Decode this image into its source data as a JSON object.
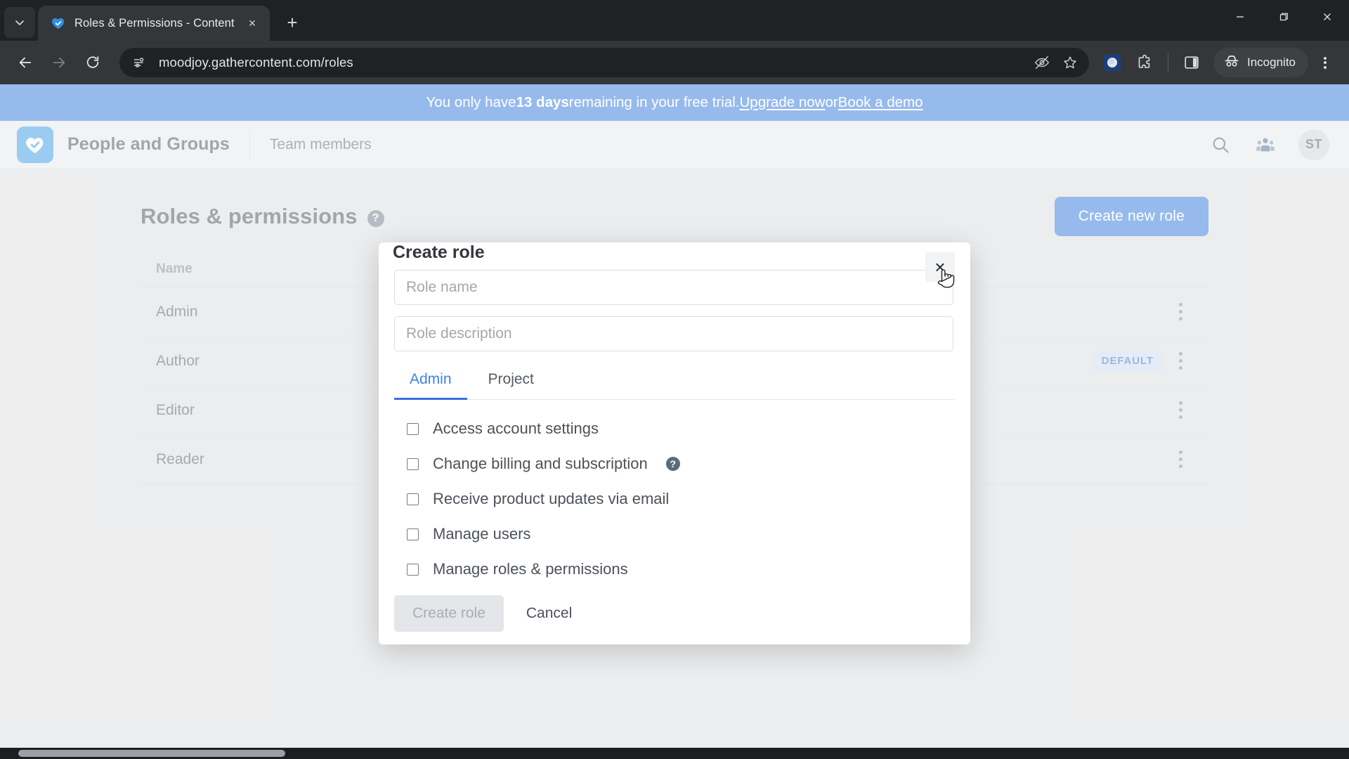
{
  "browser": {
    "tab": {
      "title": "Roles & Permissions - Content",
      "favicon": "gathercontent-heart-icon",
      "close_icon": "×",
      "new_tab_icon": "+",
      "tab_search_icon": "chevron-down-icon"
    },
    "window_controls": {
      "minimize": "minimize-icon",
      "maximize": "maximize-icon",
      "close": "close-icon"
    },
    "toolbar": {
      "back_icon": "arrow-left-icon",
      "forward_icon": "arrow-right-icon",
      "reload_icon": "reload-icon",
      "site_info_icon": "site-settings-icon",
      "url": "moodjoy.gathercontent.com/roles",
      "tracking_icon": "eye-slash-icon",
      "bookmark_icon": "star-icon",
      "profile_icon": "profile-avatar-icon",
      "extensions_icon": "puzzle-piece-icon",
      "sidepanel_icon": "side-panel-icon",
      "incognito_label": "Incognito",
      "incognito_icon": "incognito-hat-icon",
      "menu_icon": "three-dots-vertical-icon"
    }
  },
  "banner": {
    "prefix": "You only have ",
    "days": "13 days",
    "middle": " remaining in your free trial. ",
    "link_upgrade": "Upgrade now",
    "conjunction": " or ",
    "link_demo": "Book a demo",
    "bg_color": "#1a66d8"
  },
  "app_header": {
    "logo": "gathercontent-logo-icon",
    "brand": "People and Groups",
    "nav_item": "Team members",
    "search_icon": "search-icon",
    "groups_icon": "people-group-icon",
    "avatar_initials": "ST"
  },
  "page": {
    "title": "Roles & permissions",
    "title_help_icon": "question-mark-icon",
    "create_button": "Create new role",
    "accent_color": "#1a66d8",
    "table": {
      "columns": [
        "Name"
      ],
      "rows": [
        {
          "name": "Admin",
          "badge": ""
        },
        {
          "name": "Author",
          "badge": "DEFAULT"
        },
        {
          "name": "Editor",
          "badge": ""
        },
        {
          "name": "Reader",
          "badge": ""
        }
      ],
      "row_menu_icon": "three-dots-vertical-icon",
      "badge_text": "DEFAULT"
    }
  },
  "modal": {
    "title": "Create role",
    "close_icon": "×",
    "name_placeholder": "Role name",
    "name_value": "",
    "description_placeholder": "Role description",
    "description_value": "",
    "tabs": [
      {
        "label": "Admin",
        "active": true
      },
      {
        "label": "Project",
        "active": false
      }
    ],
    "permissions": [
      {
        "label": "Access account settings",
        "checked": false,
        "help": false
      },
      {
        "label": "Change billing and subscription",
        "checked": false,
        "help": true
      },
      {
        "label": "Receive product updates via email",
        "checked": false,
        "help": false
      },
      {
        "label": "Manage users",
        "checked": false,
        "help": false
      },
      {
        "label": "Manage roles & permissions",
        "checked": false,
        "help": false
      }
    ],
    "help_icon": "question-mark-icon",
    "submit_label": "Create role",
    "cancel_label": "Cancel"
  }
}
